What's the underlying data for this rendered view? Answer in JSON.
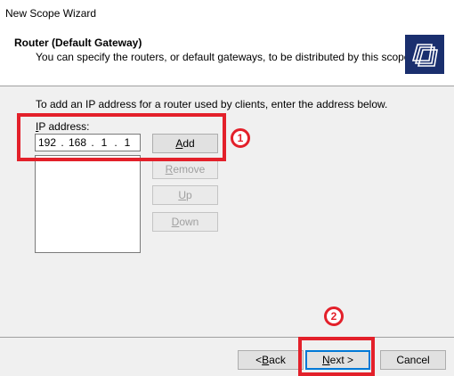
{
  "window": {
    "title": "New Scope Wizard"
  },
  "header": {
    "title": "Router (Default Gateway)",
    "subtitle": "You can specify the routers, or default gateways, to be distributed by this scope."
  },
  "main": {
    "instruction": "To add an IP address for a router used by clients, enter the address below.",
    "ip_label_accel": "I",
    "ip_label_rest": "P address:",
    "ip_value": {
      "o1": "192",
      "o2": "168",
      "o3": "1",
      "o4": "1",
      "dot": "."
    },
    "router_list": []
  },
  "buttons": {
    "add": {
      "accel": "A",
      "rest": "dd"
    },
    "remove": {
      "accel": "R",
      "rest": "emove"
    },
    "up": {
      "accel": "U",
      "rest": "p"
    },
    "down": {
      "accel": "D",
      "rest": "own"
    }
  },
  "footer": {
    "back": {
      "pre": "< ",
      "accel": "B",
      "rest": "ack"
    },
    "next": {
      "accel": "N",
      "rest": "ext >"
    },
    "cancel": "Cancel"
  },
  "annotations": {
    "one": "1",
    "two": "2"
  },
  "colors": {
    "annotation": "#e3202a",
    "focus": "#0078d7",
    "icon_bg": "#1a2f6e"
  }
}
